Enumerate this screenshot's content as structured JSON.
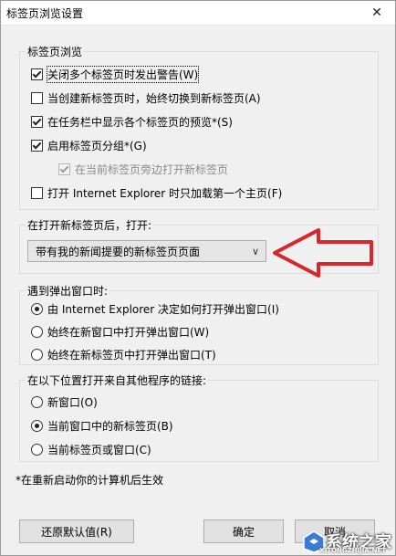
{
  "window": {
    "title": "标签页浏览设置",
    "close_glyph": "✕"
  },
  "tabbed_browsing": {
    "legend": "标签页浏览",
    "items": [
      {
        "label": "关闭多个标签页时发出警告(W)",
        "checked": true
      },
      {
        "label": "当创建新标签页时，始终切换到新标签页(A)",
        "checked": false
      },
      {
        "label": "在任务栏中显示各个标签页的预览*(S)",
        "checked": true
      },
      {
        "label": "启用标签页分组*(G)",
        "checked": true
      },
      {
        "label": "在当前标签页旁边打开新标签页",
        "checked": true,
        "disabled": true
      },
      {
        "label": "打开 Internet Explorer 时只加载第一个主页(F)",
        "checked": false
      }
    ]
  },
  "new_tab": {
    "legend": "在打开新标签页后，打开:",
    "selected": "带有我的新闻提要的新标签页页面"
  },
  "popup": {
    "legend": "遇到弹出窗口时:",
    "options": [
      {
        "label": "由 Internet Explorer 决定如何打开弹出窗口(I)",
        "selected": true
      },
      {
        "label": "始终在新窗口中打开弹出窗口(W)",
        "selected": false
      },
      {
        "label": "始终在新标签页中打开弹出窗口(T)",
        "selected": false
      }
    ]
  },
  "external_links": {
    "legend": "在以下位置打开来自其他程序的链接:",
    "options": [
      {
        "label": "新窗口(O)",
        "selected": false
      },
      {
        "label": "当前窗口中的新标签页(B)",
        "selected": true
      },
      {
        "label": "当前标签页或窗口(C)",
        "selected": false
      }
    ]
  },
  "footnote": "*在重新启动你的计算机后生效",
  "buttons": {
    "restore": "还原默认值(R)",
    "ok": "确定",
    "cancel": "取消"
  },
  "annotation": {
    "arrow_color": "#d9262b"
  },
  "watermark": {
    "text": "系统之家",
    "sub": "XITONGZHIJIA.NET"
  }
}
